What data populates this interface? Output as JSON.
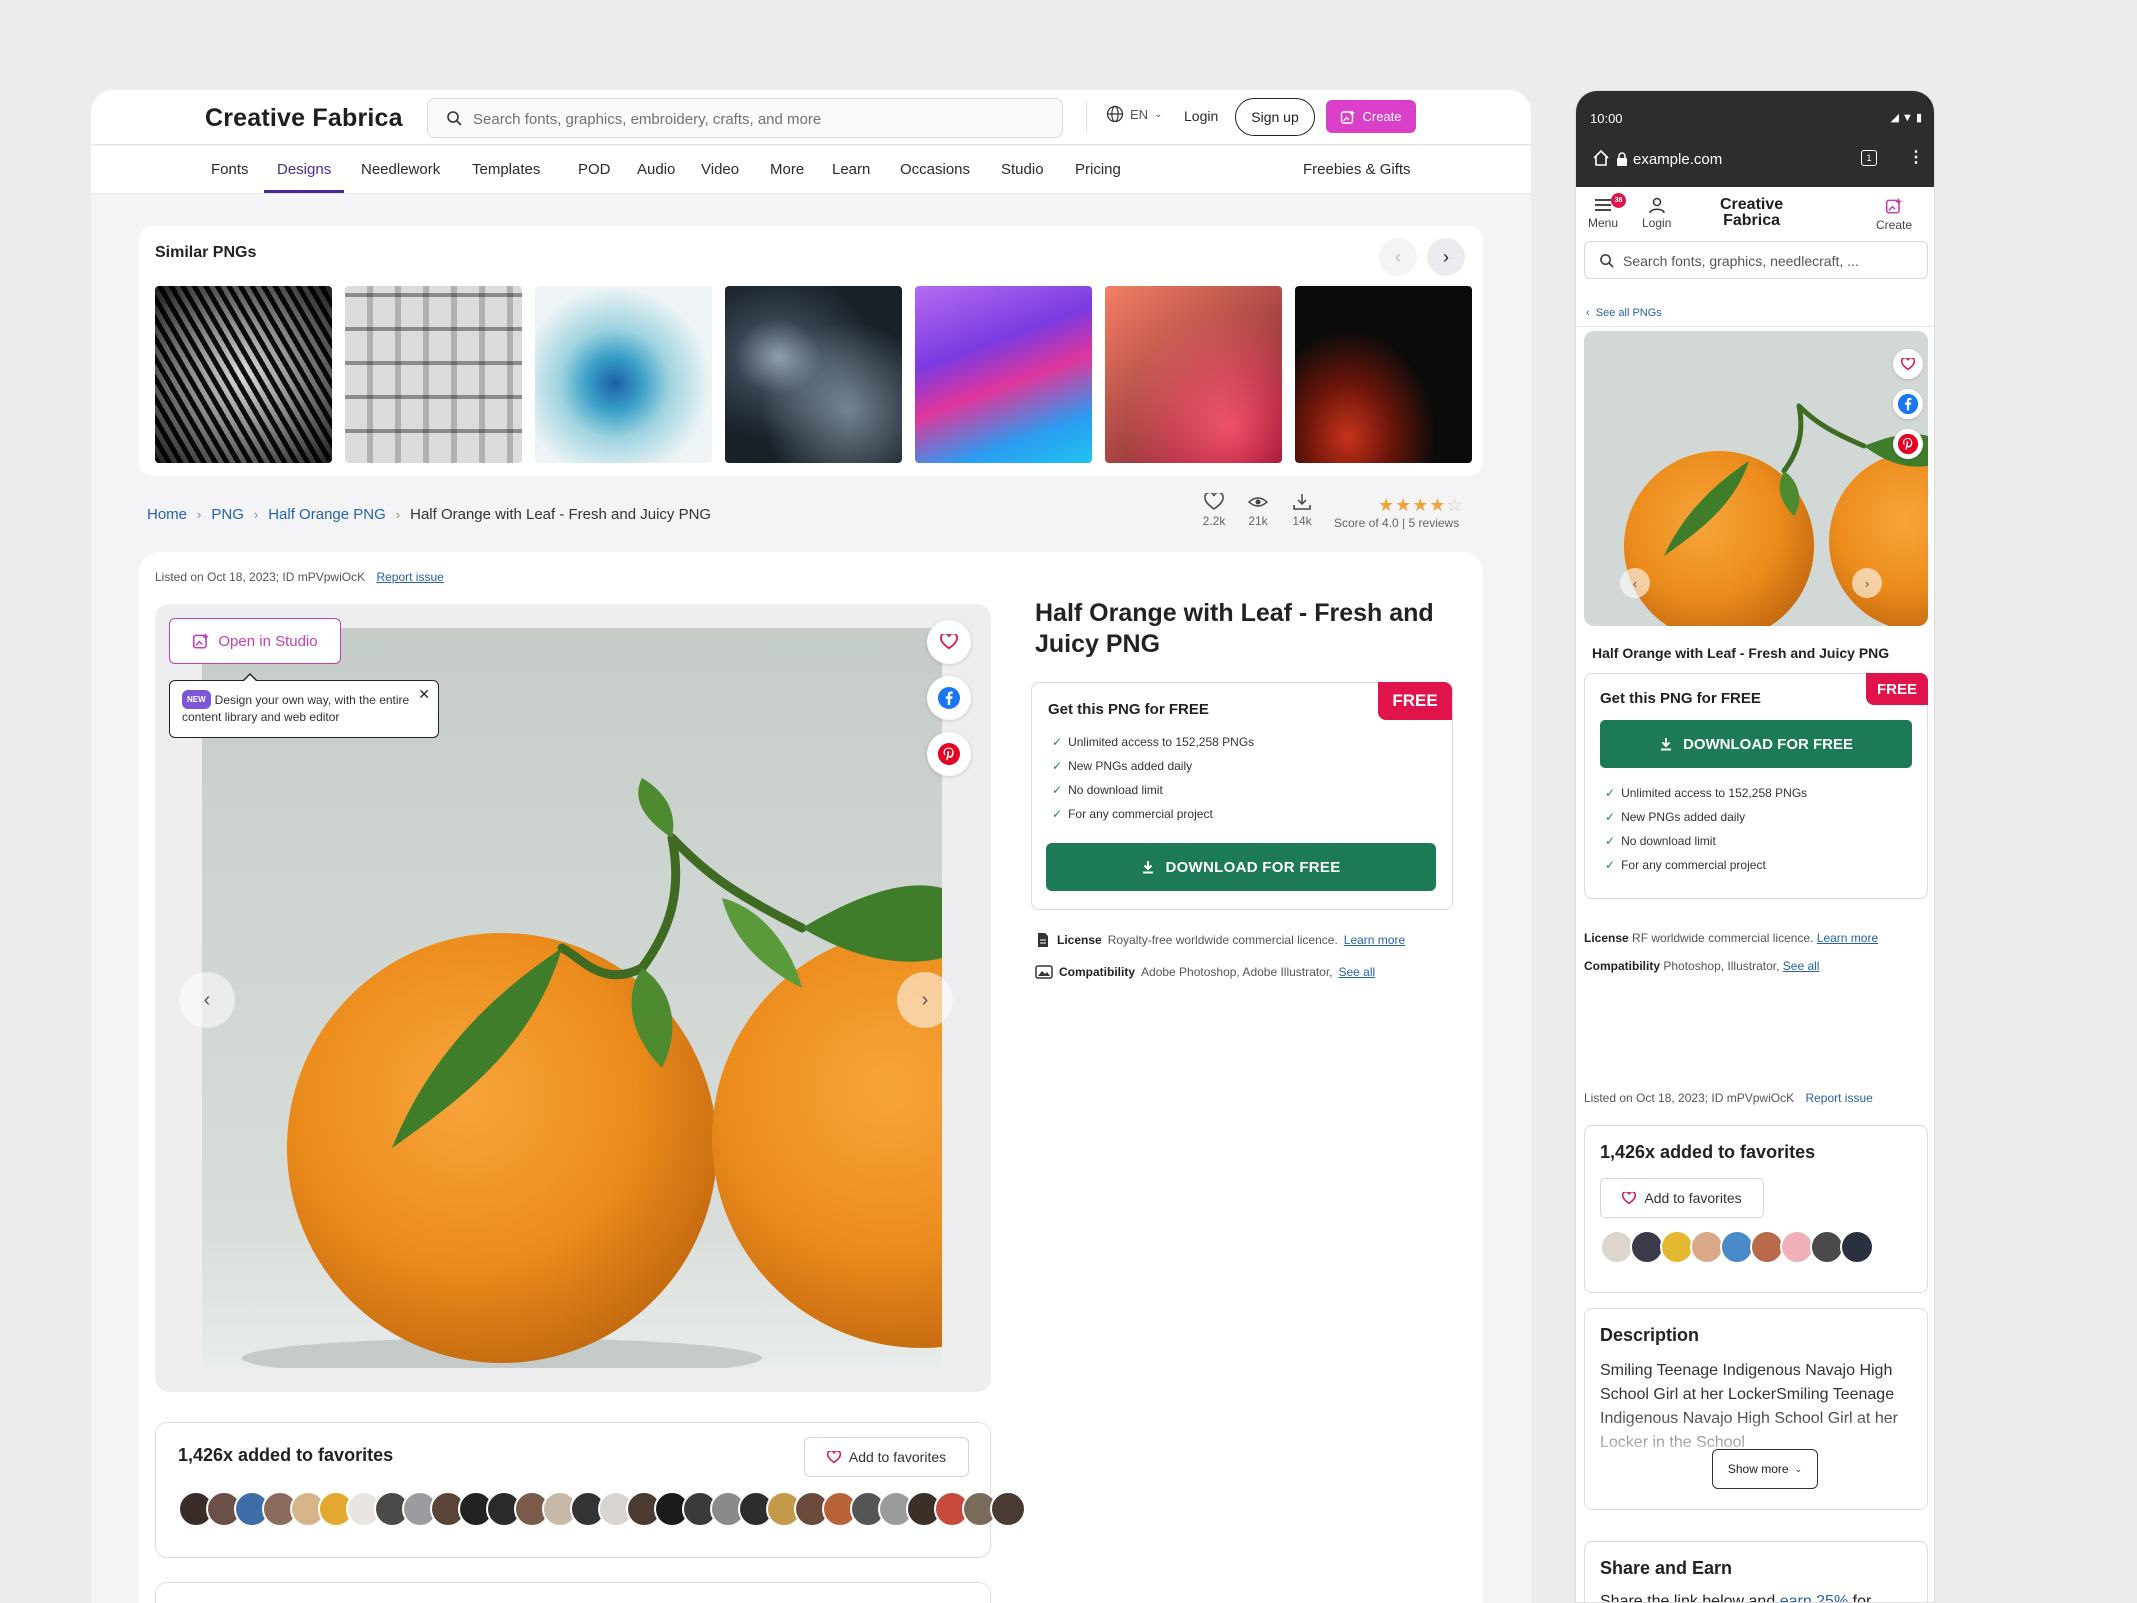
{
  "desktop": {
    "logo": "Creative Fabrica",
    "search_placeholder": "Search fonts, graphics, embroidery, crafts, and more",
    "lang": "EN",
    "login": "Login",
    "signup": "Sign up",
    "create": "Create",
    "nav": [
      "Fonts",
      "Designs",
      "Needlework",
      "Templates",
      "POD",
      "Audio",
      "Video",
      "More",
      "Learn",
      "Occasions",
      "Studio",
      "Pricing"
    ],
    "nav_right": "Freebies & Gifts",
    "similar_title": "Similar PNGs",
    "breadcrumb": [
      "Home",
      "PNG",
      "Half Orange PNG"
    ],
    "breadcrumb_current": "Half Orange with Leaf - Fresh and Juicy PNG",
    "stats": {
      "likes": "2.2k",
      "views": "21k",
      "downloads": "14k"
    },
    "rating": {
      "score": "Score of 4.0",
      "reviews": "5 reviews",
      "stars": 4
    },
    "listed": "Listed on Oct 18, 2023;  ID mPVpwiOcK",
    "report": "Report issue",
    "open_studio": "Open in Studio",
    "tooltip_badge": "NEW",
    "tooltip": "Design your own way, with the entire content library and web editor",
    "product_title": "Half Orange with Leaf - Fresh and Juicy PNG",
    "get_title": "Get this PNG for FREE",
    "free_badge": "FREE",
    "features": [
      "Unlimited access to 152,258 PNGs",
      "New PNGs added daily",
      "No download limit",
      "For any commercial project"
    ],
    "download": "DOWNLOAD FOR FREE",
    "license_label": "License",
    "license_text": "Royalty-free worldwide commercial licence.",
    "license_link": "Learn more",
    "compat_label": "Compatibility",
    "compat_text": "Adobe Photoshop, Adobe Illustrator,",
    "compat_link": "See all",
    "fav_title": "1,426x added to favorites",
    "add_fav": "Add to favorites"
  },
  "mobile": {
    "time": "10:00",
    "url": "example.com",
    "tab_count": "1",
    "menu": "Menu",
    "menu_badge": "38",
    "login": "Login",
    "logo_l1": "Creative",
    "logo_l2": "Fabrica",
    "create": "Create",
    "search_placeholder": "Search fonts, graphics, needlecraft, ...",
    "see_all": "See all PNGs",
    "title": "Half Orange with Leaf - Fresh and Juicy PNG",
    "get_title": "Get this PNG for FREE",
    "free_badge": "FREE",
    "download": "DOWNLOAD FOR FREE",
    "features": [
      "Unlimited access to 152,258 PNGs",
      "New PNGs added daily",
      "No download limit",
      "For any commercial project"
    ],
    "license_label": "License",
    "license_text": "RF worldwide commercial licence.",
    "license_link": "Learn more",
    "compat_label": "Compatibility",
    "compat_text": "Photoshop, Illustrator,",
    "compat_link": "See all",
    "listed": "Listed on Oct 18, 2023;  ID mPVpwiOcK",
    "report": "Report issue",
    "fav_title": "1,426x added to favorites",
    "add_fav": "Add to favorites",
    "desc_title": "Description",
    "desc_text": "Smiling Teenage Indigenous Navajo High School Girl at her LockerSmiling Teenage Indigenous Navajo High School Girl at her Locker in the School",
    "show_more": "Show more",
    "share_title": "Share and Earn",
    "share_pre": "Share the link below and",
    "share_link": "earn 25%",
    "share_post": "for every purchase made by any customer using your link!"
  },
  "colors": {
    "brand_purple": "#4a2a9a",
    "create_pink": "#d93fc8",
    "free_red": "#e0134b",
    "download_green": "#1c7a56",
    "link_blue": "#2563a8"
  }
}
